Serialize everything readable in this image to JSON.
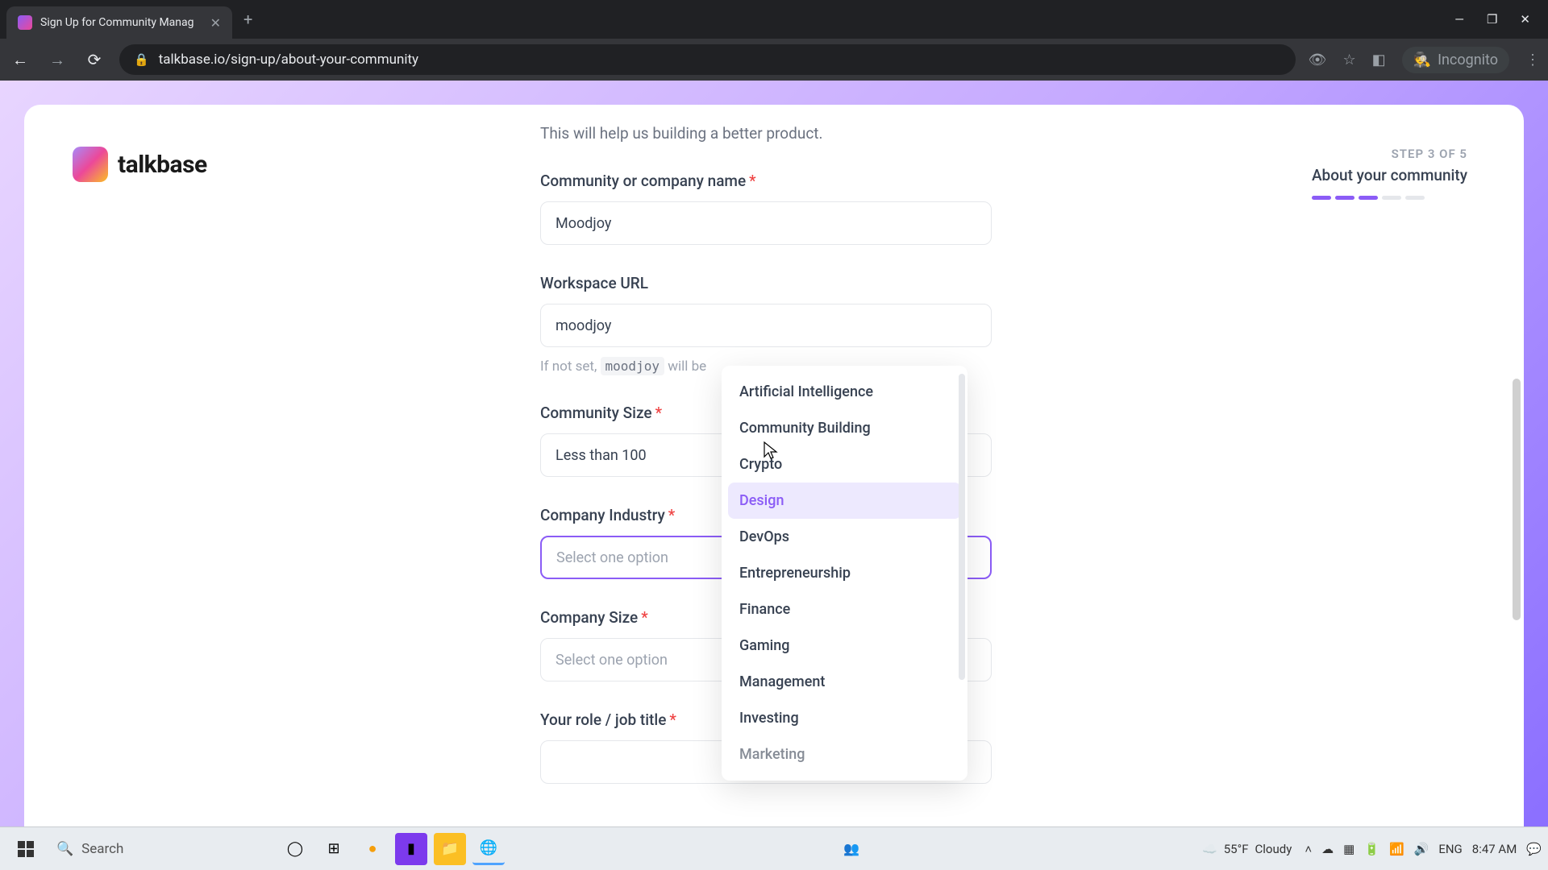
{
  "browser": {
    "tab_title": "Sign Up for Community Manag",
    "url": "talkbase.io/sign-up/about-your-community",
    "incognito_label": "Incognito"
  },
  "logo_text": "talkbase",
  "step": {
    "label": "STEP 3 OF 5",
    "title": "About your community"
  },
  "form": {
    "subtitle": "This will help us building a better product.",
    "community_name": {
      "label": "Community or company name",
      "value": "Moodjoy"
    },
    "workspace_url": {
      "label": "Workspace URL",
      "value": "moodjoy",
      "hint_prefix": "If not set, ",
      "hint_code": "moodjoy",
      "hint_suffix": " will be"
    },
    "community_size": {
      "label": "Community Size",
      "value": "Less than 100"
    },
    "company_industry": {
      "label": "Company Industry",
      "placeholder": "Select one option"
    },
    "company_size": {
      "label": "Company Size",
      "placeholder": "Select one option"
    },
    "role": {
      "label": "Your role / job title"
    }
  },
  "dropdown": {
    "items": [
      "Artificial Intelligence",
      "Community Building",
      "Crypto",
      "Design",
      "DevOps",
      "Entrepreneurship",
      "Finance",
      "Gaming",
      "Management",
      "Investing",
      "Marketing"
    ]
  },
  "taskbar": {
    "search_placeholder": "Search",
    "weather_temp": "55°F",
    "weather_cond": "Cloudy",
    "lang": "ENG",
    "time": "8:47 AM"
  }
}
